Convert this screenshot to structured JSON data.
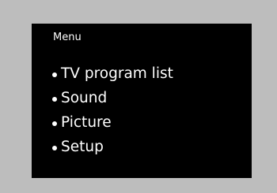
{
  "colors": {
    "frame": "#bdbdbd",
    "screen": "#000000",
    "text": "#ffffff"
  },
  "menu": {
    "title": "Menu",
    "items": [
      {
        "label": "TV program list",
        "icon": "bullet-icon"
      },
      {
        "label": "Sound",
        "icon": "bullet-icon"
      },
      {
        "label": "Picture",
        "icon": "bullet-icon"
      },
      {
        "label": "Setup",
        "icon": "bullet-icon"
      }
    ]
  }
}
